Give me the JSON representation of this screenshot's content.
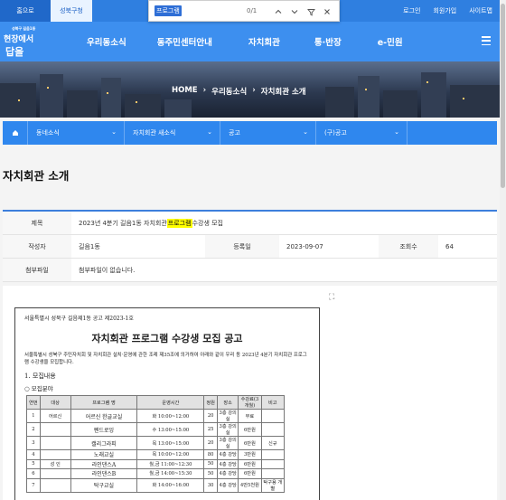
{
  "find_bar": {
    "query": "프로그램",
    "count": "0/1"
  },
  "util_bar": {
    "home_tab": "홈으로",
    "gu_tab": "성북구청",
    "links": [
      "로그인",
      "회원가입",
      "사이트맵"
    ]
  },
  "logo": {
    "line1": "성북구 길음1동",
    "line2": "현장에서",
    "line3": "답을"
  },
  "main_nav": [
    "우리동소식",
    "동주민센터안내",
    "자치회관",
    "통·반장",
    "e-민원"
  ],
  "breadcrumb": [
    "HOME",
    "우리동소식",
    "자치회관 소개"
  ],
  "sub_nav": [
    "동네소식",
    "자치회관 새소식",
    "공고",
    "(구)공고"
  ],
  "page_title": "자치회관 소개",
  "post": {
    "title_label": "제목",
    "title_prefix": "2023년 4분기 길음1동 자치회관 ",
    "title_highlight": "프로그램",
    "title_suffix": " 수강생 모집",
    "author_label": "작성자",
    "author": "길음1동",
    "date_label": "등록일",
    "date": "2023-09-07",
    "views_label": "조회수",
    "views": "64",
    "attach_label": "첨부파일",
    "attach_value": "첨부파일이 없습니다."
  },
  "document": {
    "header": "서울특별시 성북구 길음제1동 공고 제2023-1호",
    "title": "자치회관 프로그램 수강생 모집 공고",
    "intro": "서울특별시 성북구 주민자치회 및 자치회관 설치·운영에 관한 조례 제35조에 의거하여 아래와 같이 우리 동 2023년 4분기 자치회관 프로그램 수강생을 모집합니다.",
    "section": "1. 모집내용",
    "subsection": "○ 모집분야",
    "table_headers": [
      "연번",
      "대상",
      "프로그램 명",
      "운영시간",
      "정원",
      "장소",
      "수강료(3개월)",
      "비고"
    ],
    "rows": [
      [
        "1",
        "어르신",
        "어르신 한글교실",
        "화 10:00~12:00",
        "20",
        "3층 강의실",
        "무료",
        ""
      ],
      [
        "2",
        "",
        "펜드로잉",
        "수 13:00~15:00",
        "25",
        "3층 강의실",
        "6만원",
        ""
      ],
      [
        "3",
        "",
        "캘리그라피",
        "목 13:00~15:00",
        "20",
        "3층 강의실",
        "6만원",
        "신규"
      ],
      [
        "4",
        "",
        "노래교실",
        "목 10:00~12:00",
        "80",
        "4층 강당",
        "3만원",
        ""
      ],
      [
        "5",
        "성 인",
        "라인댄스A",
        "월,금 11:00~12:30",
        "50",
        "4층 강당",
        "6만원",
        ""
      ],
      [
        "6",
        "",
        "라인댄스B",
        "월,금 14:00~15:30",
        "50",
        "4층 강당",
        "6만원",
        ""
      ],
      [
        "7",
        "",
        "탁구교실",
        "화 14:00~16:00",
        "30",
        "4층 강당",
        "4만5천원",
        "탁구용 개별"
      ]
    ]
  }
}
